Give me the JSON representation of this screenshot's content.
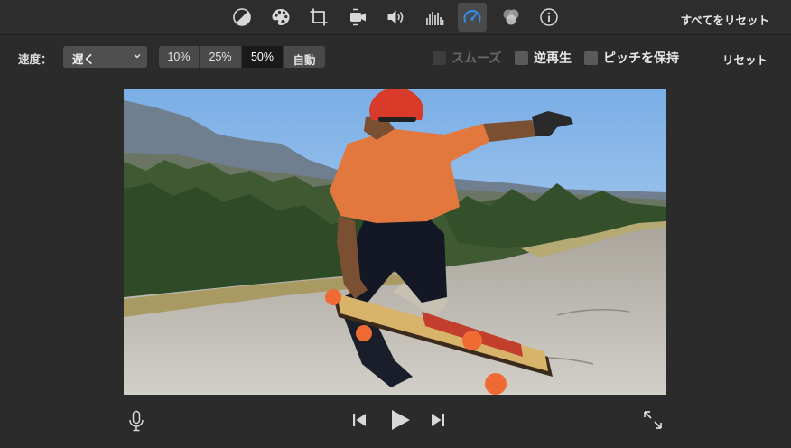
{
  "toolbar": {
    "tools": [
      "color-balance-icon",
      "color-correction-icon",
      "crop-icon",
      "stabilization-icon",
      "volume-icon",
      "noise-reduction-icon",
      "speed-icon",
      "clip-filter-icon",
      "info-icon"
    ],
    "active_tool": "speed-icon",
    "reset_all_label": "すべてをリセット"
  },
  "speed": {
    "label": "速度：",
    "selected": "遅く",
    "presets": [
      "10%",
      "25%",
      "50%",
      "自動"
    ],
    "selected_preset": "50%",
    "smooth_label": "スムーズ",
    "reverse_label": "逆再生",
    "pitch_label": "ピッチを保持",
    "reset_label": "リセット"
  },
  "colors": {
    "background": "#2b2b2b",
    "active_tool": "#4a4a4a",
    "accent": "#2f8ff0"
  },
  "transport": {
    "icons": [
      "microphone-icon",
      "previous-icon",
      "play-icon",
      "next-icon",
      "fullscreen-icon"
    ]
  }
}
